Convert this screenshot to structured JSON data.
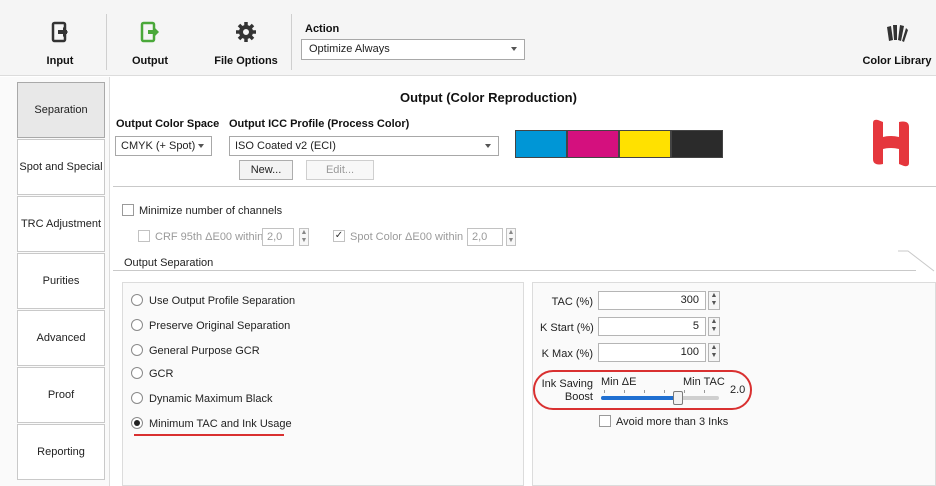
{
  "toolbar": {
    "input_label": "Input",
    "output_label": "Output",
    "file_options_label": "File Options",
    "action_label": "Action",
    "action_value": "Optimize Always",
    "color_library_label": "Color Library"
  },
  "sidebar": {
    "items": [
      {
        "label": "Separation",
        "active": true
      },
      {
        "label": "Spot and Special"
      },
      {
        "label": "TRC Adjustment"
      },
      {
        "label": "Purities"
      },
      {
        "label": "Advanced"
      },
      {
        "label": "Proof"
      },
      {
        "label": "Reporting"
      }
    ]
  },
  "main": {
    "title": "Output (Color Reproduction)",
    "output_color_space_label": "Output Color Space",
    "output_color_space_value": "CMYK (+ Spot)",
    "icc_profile_label": "Output ICC Profile (Process Color)",
    "icc_profile_value": "ISO Coated v2 (ECI)",
    "new_button": "New...",
    "edit_button": "Edit...",
    "swatch_colors": [
      "#0096d6",
      "#d4107e",
      "#ffe100",
      "#2b2b2b"
    ],
    "logo_color": "#e5373d"
  },
  "options": {
    "minimize_channels_label": "Minimize number of channels",
    "minimize_channels_checked": false,
    "crf_label": "CRF 95th ΔE00 within",
    "crf_checked": false,
    "crf_value": "2,0",
    "spot_label": "Spot Color ΔE00 within",
    "spot_checked": true,
    "spot_value": "2,0"
  },
  "output_separation": {
    "group_label": "Output Separation",
    "radios": [
      {
        "label": "Use Output Profile Separation",
        "checked": false
      },
      {
        "label": "Preserve Original Separation",
        "checked": false
      },
      {
        "label": "General Purpose GCR",
        "checked": false
      },
      {
        "label": "GCR",
        "checked": false
      },
      {
        "label": "Dynamic Maximum Black",
        "checked": false
      },
      {
        "label": "Minimum TAC and Ink Usage",
        "checked": true
      }
    ],
    "tac_label": "TAC (%)",
    "tac_value": "300",
    "k_start_label": "K Start (%)",
    "k_start_value": "5",
    "k_max_label": "K Max (%)",
    "k_max_value": "100",
    "ink_saving_label_1": "Ink Saving",
    "ink_saving_label_2": "Boost",
    "slider_min_label": "Min ΔE",
    "slider_max_label": "Min TAC",
    "slider_value": "2.0",
    "slider_fraction": 0.67,
    "avoid_inks_label": "Avoid more than 3 Inks",
    "avoid_inks_checked": false
  },
  "colors": {
    "accent_red": "#d93030",
    "slider_blue": "#1f6fd1"
  }
}
